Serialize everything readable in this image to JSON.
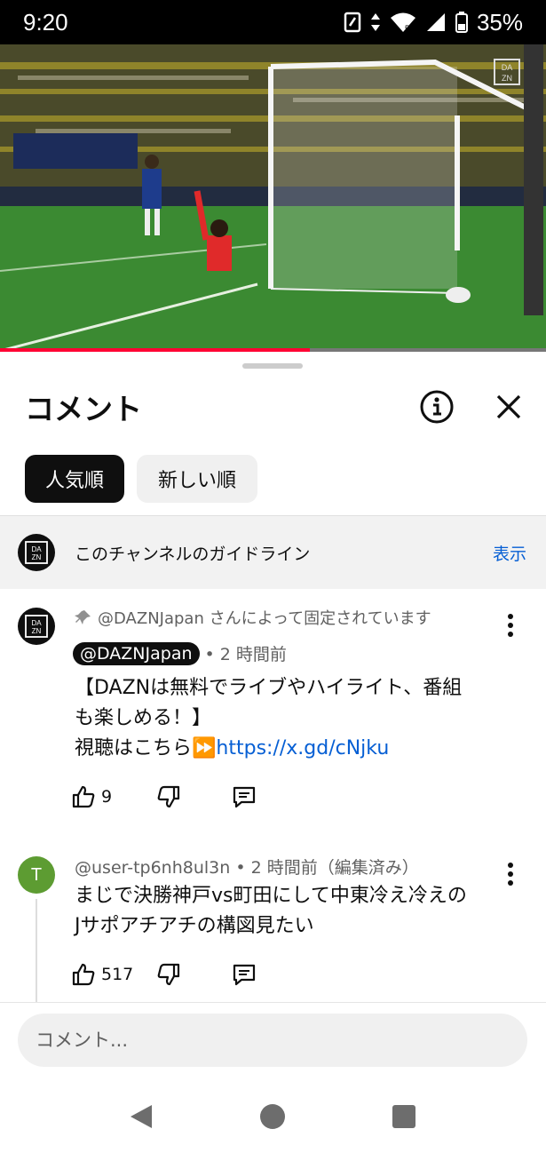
{
  "status_bar": {
    "time": "9:20",
    "battery": "35%",
    "icons": [
      "nfc-icon",
      "data-arrows-icon",
      "wifi-icon",
      "signal-icon",
      "battery-icon"
    ]
  },
  "video": {
    "watermark": "DAZN",
    "progress": 0.567
  },
  "sheet": {
    "title": "コメント",
    "chips": [
      {
        "label": "人気順",
        "active": true
      },
      {
        "label": "新しい順",
        "active": false
      }
    ],
    "guideline": {
      "text": "このチャンネルのガイドライン",
      "action": "表示"
    }
  },
  "comments": [
    {
      "pinned_text": "@DAZNJapan さんによって固定されています",
      "author": "@DAZNJapan",
      "time": "• 2 時間前",
      "body_line1": "【DAZNは無料でライブやハイライト、番組",
      "body_line2": "も楽しめる！】",
      "body_line3_prefix": "視聴はこちら⏩",
      "link": "https://x.gd/cNjku",
      "likes": "9"
    },
    {
      "avatar_letter": "T",
      "author_line": "@user-tp6nh8ul3n • 2 時間前（編集済み）",
      "body_line1": "まじで決勝神戸vs町田にして中東冷え冷えの",
      "body_line2": "Jサポアチアチの構図見たい",
      "likes": "517"
    }
  ],
  "input": {
    "placeholder": "コメント..."
  },
  "colors": {
    "accent_link": "#065fd4",
    "progress": "#ff0033",
    "avatar_t": "#5d9c32"
  }
}
